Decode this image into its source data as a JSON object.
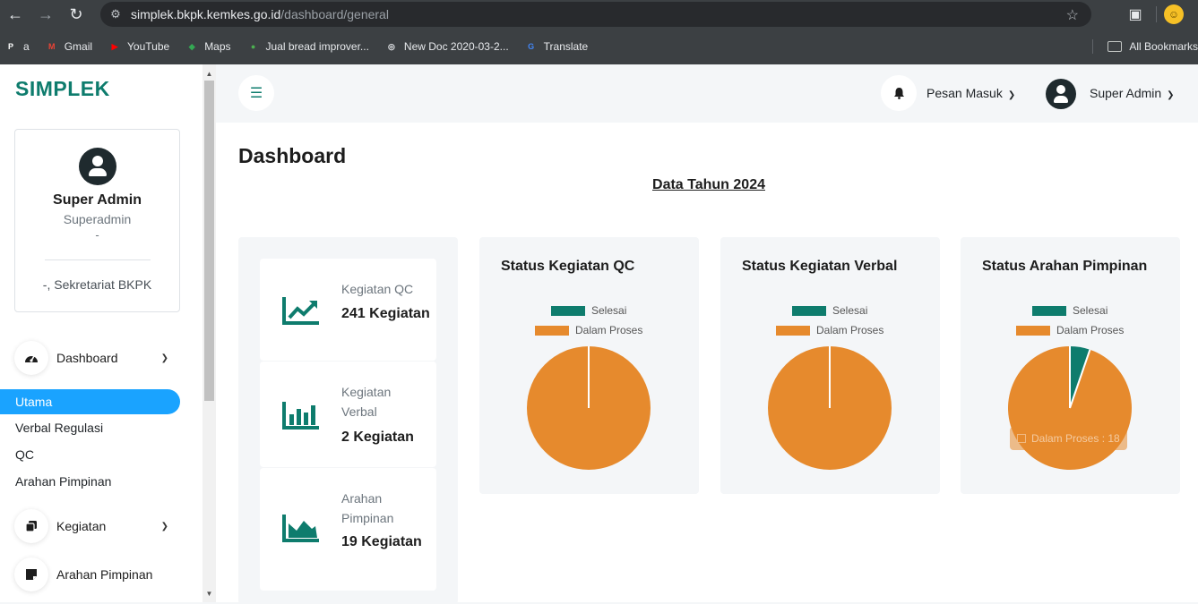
{
  "browser": {
    "url_host": "simplek.bkpk.kemkes.go.id",
    "url_path": "/dashboard/general",
    "bookmarks": [
      {
        "label": "a",
        "icon": "pp-icon",
        "color": "#ffffff"
      },
      {
        "label": "Gmail",
        "icon": "gmail-icon",
        "color": "#ea4335"
      },
      {
        "label": "YouTube",
        "icon": "youtube-icon",
        "color": "#ff0000"
      },
      {
        "label": "Maps",
        "icon": "maps-icon",
        "color": "#34a853"
      },
      {
        "label": "Jual bread improver...",
        "icon": "store-icon",
        "color": "#4caf50"
      },
      {
        "label": "New Doc 2020-03-2...",
        "icon": "globe-icon",
        "color": "#e8eaed"
      },
      {
        "label": "Translate",
        "icon": "translate-icon",
        "color": "#4285f4"
      }
    ],
    "all_bookmarks": "All Bookmarks"
  },
  "sidebar": {
    "brand": "SIMPLEK",
    "user": {
      "name": "Super Admin",
      "role": "Superadmin",
      "dash": "-",
      "unit": "-, Sekretariat BKPK"
    },
    "menu": {
      "dashboard": "Dashboard",
      "subitems": [
        "Utama",
        "Verbal Regulasi",
        "QC",
        "Arahan Pimpinan"
      ],
      "kegiatan": "Kegiatan",
      "arahan": "Arahan Pimpinan"
    }
  },
  "topbar": {
    "pesan": "Pesan Masuk",
    "user": "Super Admin"
  },
  "main": {
    "title": "Dashboard",
    "year_label": "Data Tahun 2024",
    "stats": [
      {
        "label": "Kegiatan QC",
        "value": "241 Kegiatan",
        "icon": "chart-line-up-icon"
      },
      {
        "label": "Kegiatan Verbal",
        "value": "2 Kegiatan",
        "icon": "chart-bar-icon"
      },
      {
        "label": "Arahan Pimpinan",
        "value": "19 Kegiatan",
        "icon": "chart-area-icon"
      }
    ],
    "charts": [
      {
        "title": "Status Kegiatan QC"
      },
      {
        "title": "Status Kegiatan Verbal"
      },
      {
        "title": "Status Arahan Pimpinan",
        "tooltip": "Dalam Proses : 18"
      }
    ]
  },
  "colors": {
    "selesai": "#0e7c6d",
    "dalam_proses": "#e68a2d",
    "accent": "#1aa3ff"
  },
  "chart_data": [
    {
      "type": "pie",
      "title": "Status Kegiatan QC",
      "categories": [
        "Selesai",
        "Dalam Proses"
      ],
      "values": [
        0,
        241
      ],
      "legend": "top"
    },
    {
      "type": "pie",
      "title": "Status Kegiatan Verbal",
      "categories": [
        "Selesai",
        "Dalam Proses"
      ],
      "values": [
        0,
        2
      ],
      "legend": "top"
    },
    {
      "type": "pie",
      "title": "Status Arahan Pimpinan",
      "categories": [
        "Selesai",
        "Dalam Proses"
      ],
      "values": [
        1,
        18
      ],
      "legend": "top"
    }
  ]
}
